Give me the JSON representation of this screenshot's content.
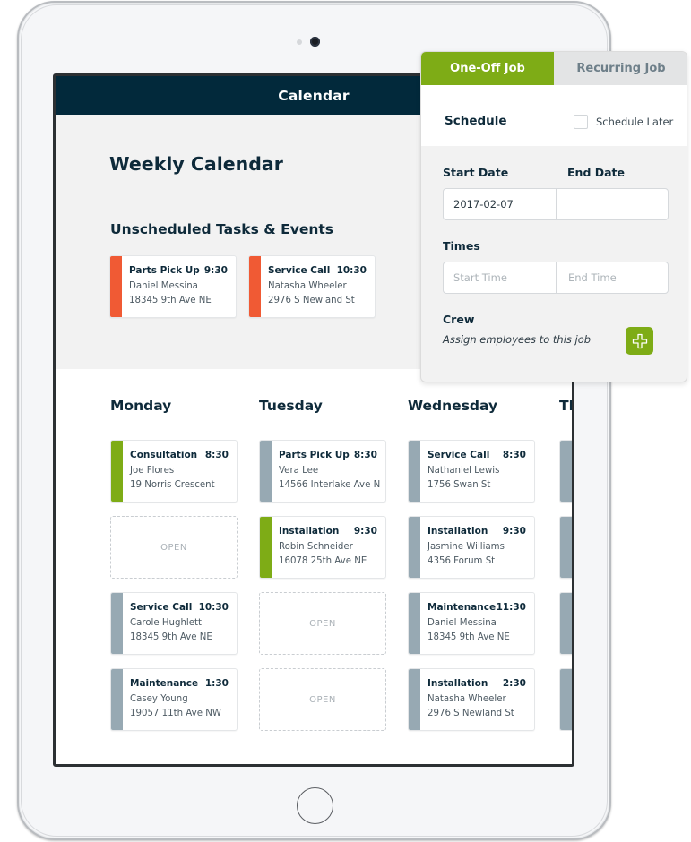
{
  "app": {
    "header_title": "Calendar",
    "page_title": "Weekly Calendar"
  },
  "colors": {
    "header_bg": "#02293b",
    "accent_green": "#7eac16",
    "unscheduled_orange": "#f05a34",
    "scheduled_grey": "#97a9b3"
  },
  "unscheduled": {
    "title": "Unscheduled Tasks & Events",
    "cards": [
      {
        "type": "Parts Pick Up",
        "time": "9:30",
        "name": "Daniel Messina",
        "address": "18345 9th Ave NE",
        "status": "unscheduled"
      },
      {
        "type": "Service Call",
        "time": "10:30",
        "name": "Natasha Wheeler",
        "address": "2976 S Newland St",
        "status": "unscheduled"
      }
    ]
  },
  "week": {
    "open_label": "OPEN",
    "days": [
      {
        "name": "Monday",
        "slots": [
          {
            "type": "Consultation",
            "time": "8:30",
            "name": "Joe Flores",
            "address": "19 Norris Crescent",
            "status": "confirmed"
          },
          {
            "open": true
          },
          {
            "type": "Service Call",
            "time": "10:30",
            "name": "Carole Hughlett",
            "address": "18345 9th Ave NE",
            "status": "scheduled"
          },
          {
            "type": "Maintenance",
            "time": "1:30",
            "name": "Casey Young",
            "address": "19057 11th Ave NW",
            "status": "scheduled"
          }
        ]
      },
      {
        "name": "Tuesday",
        "slots": [
          {
            "type": "Parts Pick Up",
            "time": "8:30",
            "name": "Vera Lee",
            "address": "14566 Interlake Ave N",
            "status": "scheduled"
          },
          {
            "type": "Installation",
            "time": "9:30",
            "name": "Robin Schneider",
            "address": "16078 25th Ave NE",
            "status": "confirmed"
          },
          {
            "open": true
          },
          {
            "open": true
          }
        ]
      },
      {
        "name": "Wednesday",
        "slots": [
          {
            "type": "Service Call",
            "time": "8:30",
            "name": "Nathaniel Lewis",
            "address": "1756 Swan St",
            "status": "scheduled"
          },
          {
            "type": "Installation",
            "time": "9:30",
            "name": "Jasmine Williams",
            "address": "4356 Forum St",
            "status": "scheduled"
          },
          {
            "type": "Maintenance",
            "time": "11:30",
            "name": "Daniel Messina",
            "address": "18345 9th Ave NE",
            "status": "scheduled"
          },
          {
            "type": "Installation",
            "time": "2:30",
            "name": "Natasha Wheeler",
            "address": "2976 S Newland St",
            "status": "scheduled"
          }
        ]
      },
      {
        "name": "Th",
        "slots": [
          {
            "status": "scheduled"
          },
          {
            "status": "scheduled"
          },
          {
            "status": "scheduled"
          },
          {
            "status": "scheduled"
          }
        ]
      }
    ]
  },
  "job_panel": {
    "tabs": [
      {
        "label": "One-Off Job",
        "active": true
      },
      {
        "label": "Recurring Job",
        "active": false
      }
    ],
    "schedule_label": "Schedule",
    "schedule_later_label": "Schedule Later",
    "schedule_later_checked": false,
    "start_date_label": "Start Date",
    "end_date_label": "End Date",
    "start_date_value": "2017-02-07",
    "end_date_value": "",
    "times_label": "Times",
    "start_time_placeholder": "Start Time",
    "end_time_placeholder": "End Time",
    "crew_label": "Crew",
    "crew_hint": "Assign employees to this job",
    "add_crew_icon": "plus-icon"
  }
}
